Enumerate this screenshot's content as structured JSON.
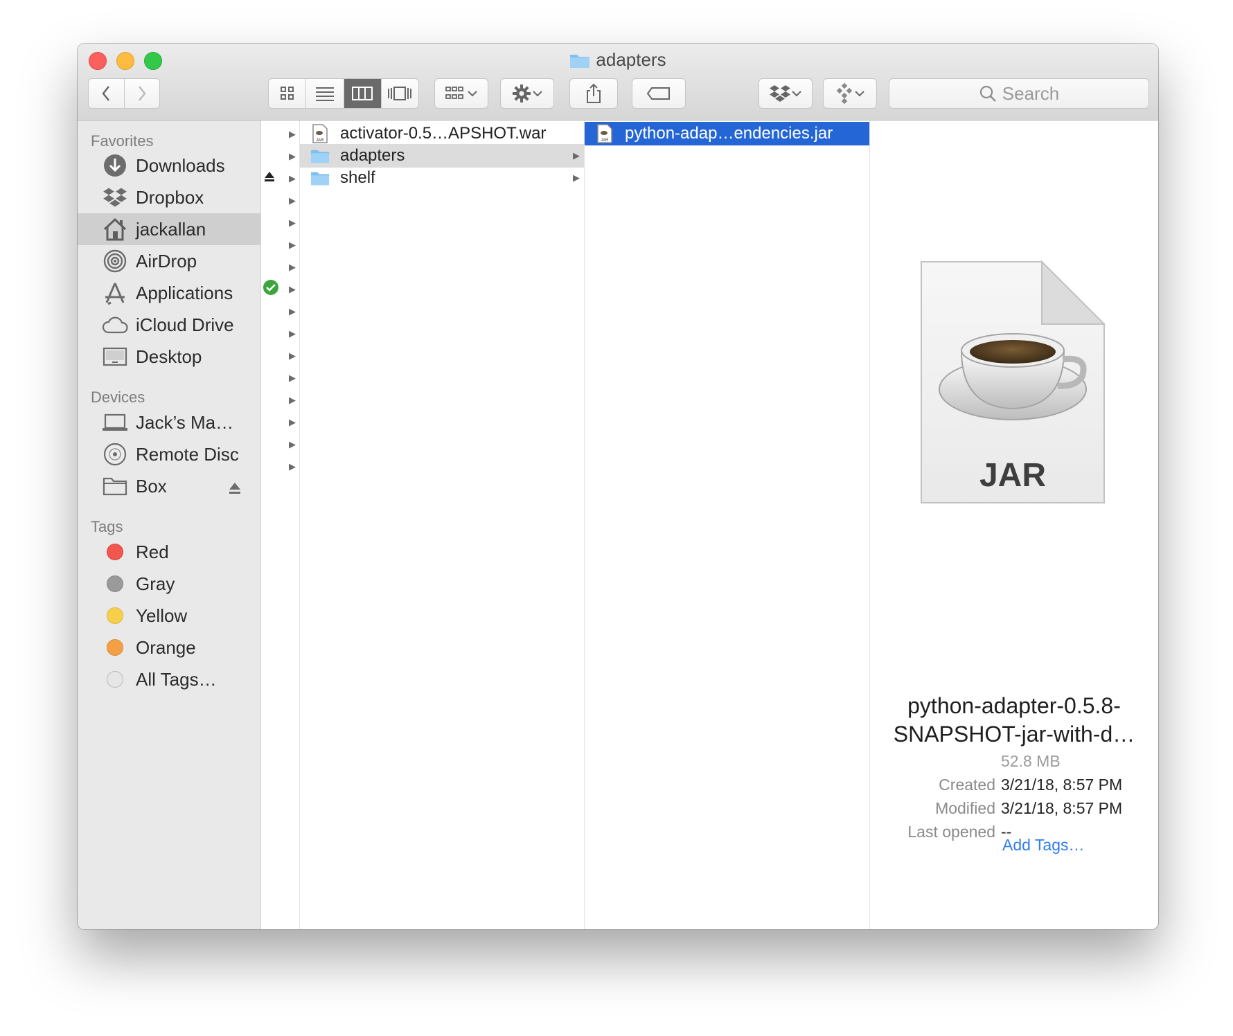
{
  "window": {
    "title": "adapters"
  },
  "toolbar": {
    "search_placeholder": "Search"
  },
  "sidebar": {
    "favorites_header": "Favorites",
    "favorites": [
      {
        "label": "Downloads",
        "icon": "downloads-icon"
      },
      {
        "label": "Dropbox",
        "icon": "dropbox-icon"
      },
      {
        "label": "jackallan",
        "icon": "home-icon",
        "selected": true
      },
      {
        "label": "AirDrop",
        "icon": "airdrop-icon"
      },
      {
        "label": "Applications",
        "icon": "applications-icon"
      },
      {
        "label": "iCloud Drive",
        "icon": "cloud-icon"
      },
      {
        "label": "Desktop",
        "icon": "desktop-icon"
      }
    ],
    "devices_header": "Devices",
    "devices": [
      {
        "label": "Jack’s Ma…",
        "icon": "laptop-icon"
      },
      {
        "label": "Remote Disc",
        "icon": "disc-icon"
      },
      {
        "label": "Box",
        "icon": "folder-icon"
      }
    ],
    "tags_header": "Tags",
    "tags": [
      {
        "label": "Red",
        "color": "#f0574e"
      },
      {
        "label": "Gray",
        "color": "#9a9a9a"
      },
      {
        "label": "Yellow",
        "color": "#f6cf4b"
      },
      {
        "label": "Orange",
        "color": "#f4a047"
      },
      {
        "label": "All Tags…",
        "color": "#e0e0e0"
      }
    ]
  },
  "columns": {
    "second": [
      {
        "name": "activator-0.5…APSHOT.war",
        "icon": "war-file-icon"
      },
      {
        "name": "adapters",
        "icon": "folder-icon",
        "selected": true
      },
      {
        "name": "shelf",
        "icon": "folder-icon"
      }
    ],
    "third": [
      {
        "name": "python-adap…endencies.jar",
        "icon": "jar-file-icon",
        "selected": true
      }
    ]
  },
  "preview": {
    "icon_label": "JAR",
    "name_line1": "python-adapter-0.5.8-",
    "name_line2": "SNAPSHOT-jar-with-d…",
    "size": "52.8 MB",
    "created_label": "Created",
    "created": "3/21/18, 8:57 PM",
    "modified_label": "Modified",
    "modified": "3/21/18, 8:57 PM",
    "last_opened_label": "Last opened",
    "last_opened": "--",
    "add_tags": "Add Tags…"
  }
}
